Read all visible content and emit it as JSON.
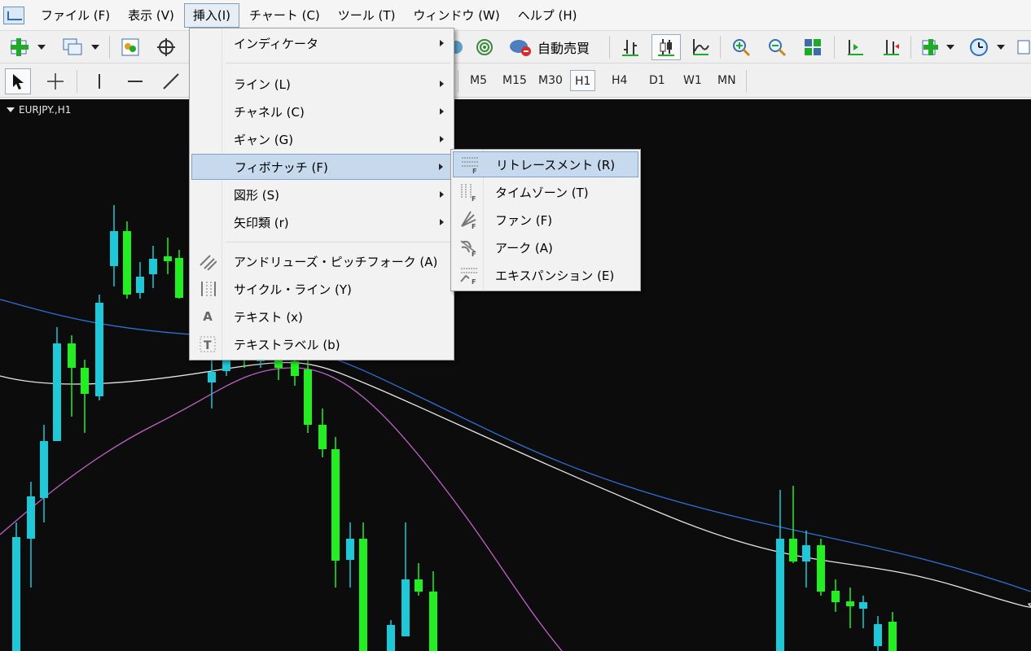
{
  "menubar": {
    "items": [
      "ファイル (F)",
      "表示 (V)",
      "挿入(I)",
      "チャート (C)",
      "ツール (T)",
      "ウィンドウ (W)",
      "ヘルプ (H)"
    ]
  },
  "toolbar": {
    "autotrade_label": "自動売買",
    "timeframes": [
      "M5",
      "M15",
      "M30",
      "H1",
      "H4",
      "D1",
      "W1",
      "MN"
    ],
    "selected_timeframe": "H1"
  },
  "chart": {
    "title": "EURJPY.,H1",
    "background": "#0c0c0c",
    "bull_color": "#22ee22",
    "bear_color": "#1ec8d6",
    "ma_colors": [
      "#2f6fd6",
      "#e6e6e6",
      "#c060c8"
    ]
  },
  "insert_menu": {
    "items": [
      {
        "label": "インディケータ",
        "submenu": true
      },
      {
        "label": "ライン (L)",
        "submenu": true
      },
      {
        "label": "チャネル (C)",
        "submenu": true
      },
      {
        "label": "ギャン (G)",
        "submenu": true
      },
      {
        "label": "フィボナッチ (F)",
        "submenu": true,
        "highlighted": true
      },
      {
        "label": "図形 (S)",
        "submenu": true
      },
      {
        "label": "矢印類 (r)",
        "submenu": true
      },
      {
        "label": "アンドリューズ・ピッチフォーク (A)",
        "icon": "pitchfork-icon"
      },
      {
        "label": "サイクル・ライン (Y)",
        "icon": "cycle-lines-icon"
      },
      {
        "label": "テキスト (x)",
        "icon": "text-icon"
      },
      {
        "label": "テキストラベル (b)",
        "icon": "text-label-icon"
      }
    ]
  },
  "fibo_menu": {
    "items": [
      {
        "label": "リトレースメント (R)",
        "icon": "fibo-retracement-icon",
        "highlighted": true
      },
      {
        "label": "タイムゾーン (T)",
        "icon": "fibo-timezones-icon"
      },
      {
        "label": "ファン (F)",
        "icon": "fibo-fan-icon"
      },
      {
        "label": "アーク (A)",
        "icon": "fibo-arcs-icon"
      },
      {
        "label": "エキスパンション (E)",
        "icon": "fibo-expansion-icon"
      }
    ]
  }
}
